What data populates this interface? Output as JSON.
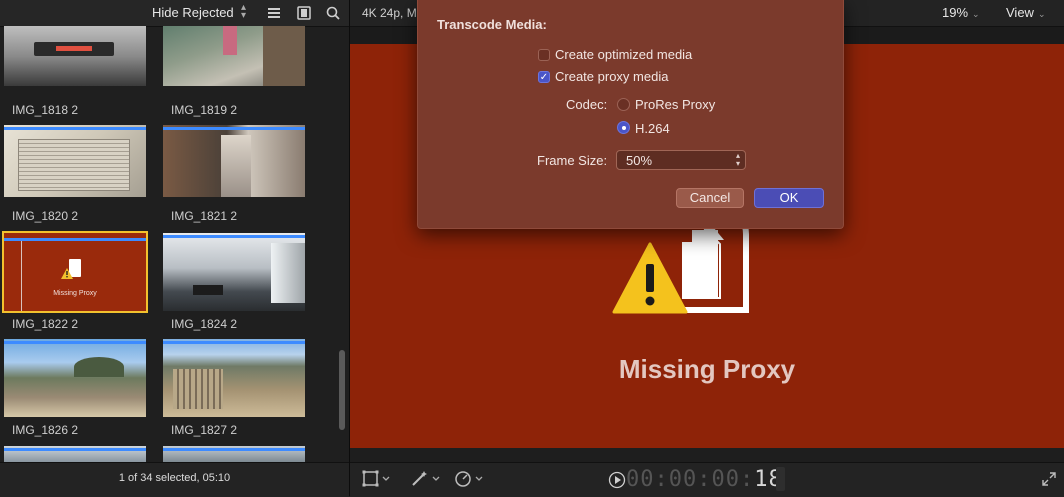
{
  "browser": {
    "filter_label": "Hide Rejected",
    "clips": [
      {
        "name": "IMG_1818 2",
        "selected": false
      },
      {
        "name": "IMG_1819 2",
        "selected": false
      },
      {
        "name": "IMG_1820 2",
        "selected": false
      },
      {
        "name": "IMG_1821 2",
        "selected": false
      },
      {
        "name": "IMG_1822 2",
        "selected": true
      },
      {
        "name": "IMG_1824 2",
        "selected": false
      },
      {
        "name": "IMG_1826 2",
        "selected": false
      },
      {
        "name": "IMG_1827 2",
        "selected": false
      }
    ],
    "thumb_missing_label": "Missing Proxy",
    "status": "1 of 34 selected, 05:10"
  },
  "viewer": {
    "format": "4K 24p, M",
    "zoom": "19%",
    "view_label": "View",
    "missing_title": "Missing Proxy",
    "timecode_prefix": "00:00:00:",
    "timecode_frames": "18",
    "canvas_color": "#8e2308"
  },
  "dialog": {
    "title": "Transcode Media:",
    "optimized_label": "Create optimized media",
    "optimized_checked": false,
    "proxy_label": "Create proxy media",
    "proxy_checked": true,
    "codec_label": "Codec:",
    "codec_options": [
      "ProRes Proxy",
      "H.264"
    ],
    "codec_selected": "H.264",
    "frame_size_label": "Frame Size:",
    "frame_size_value": "50%",
    "cancel_label": "Cancel",
    "ok_label": "OK"
  },
  "icons": [
    "browser-list-icon",
    "filmstrip-icon",
    "search-icon",
    "transform-icon",
    "magic-wand-icon",
    "speed-icon",
    "play-icon",
    "fullscreen-icon",
    "missing-file-icon",
    "warning-icon"
  ]
}
